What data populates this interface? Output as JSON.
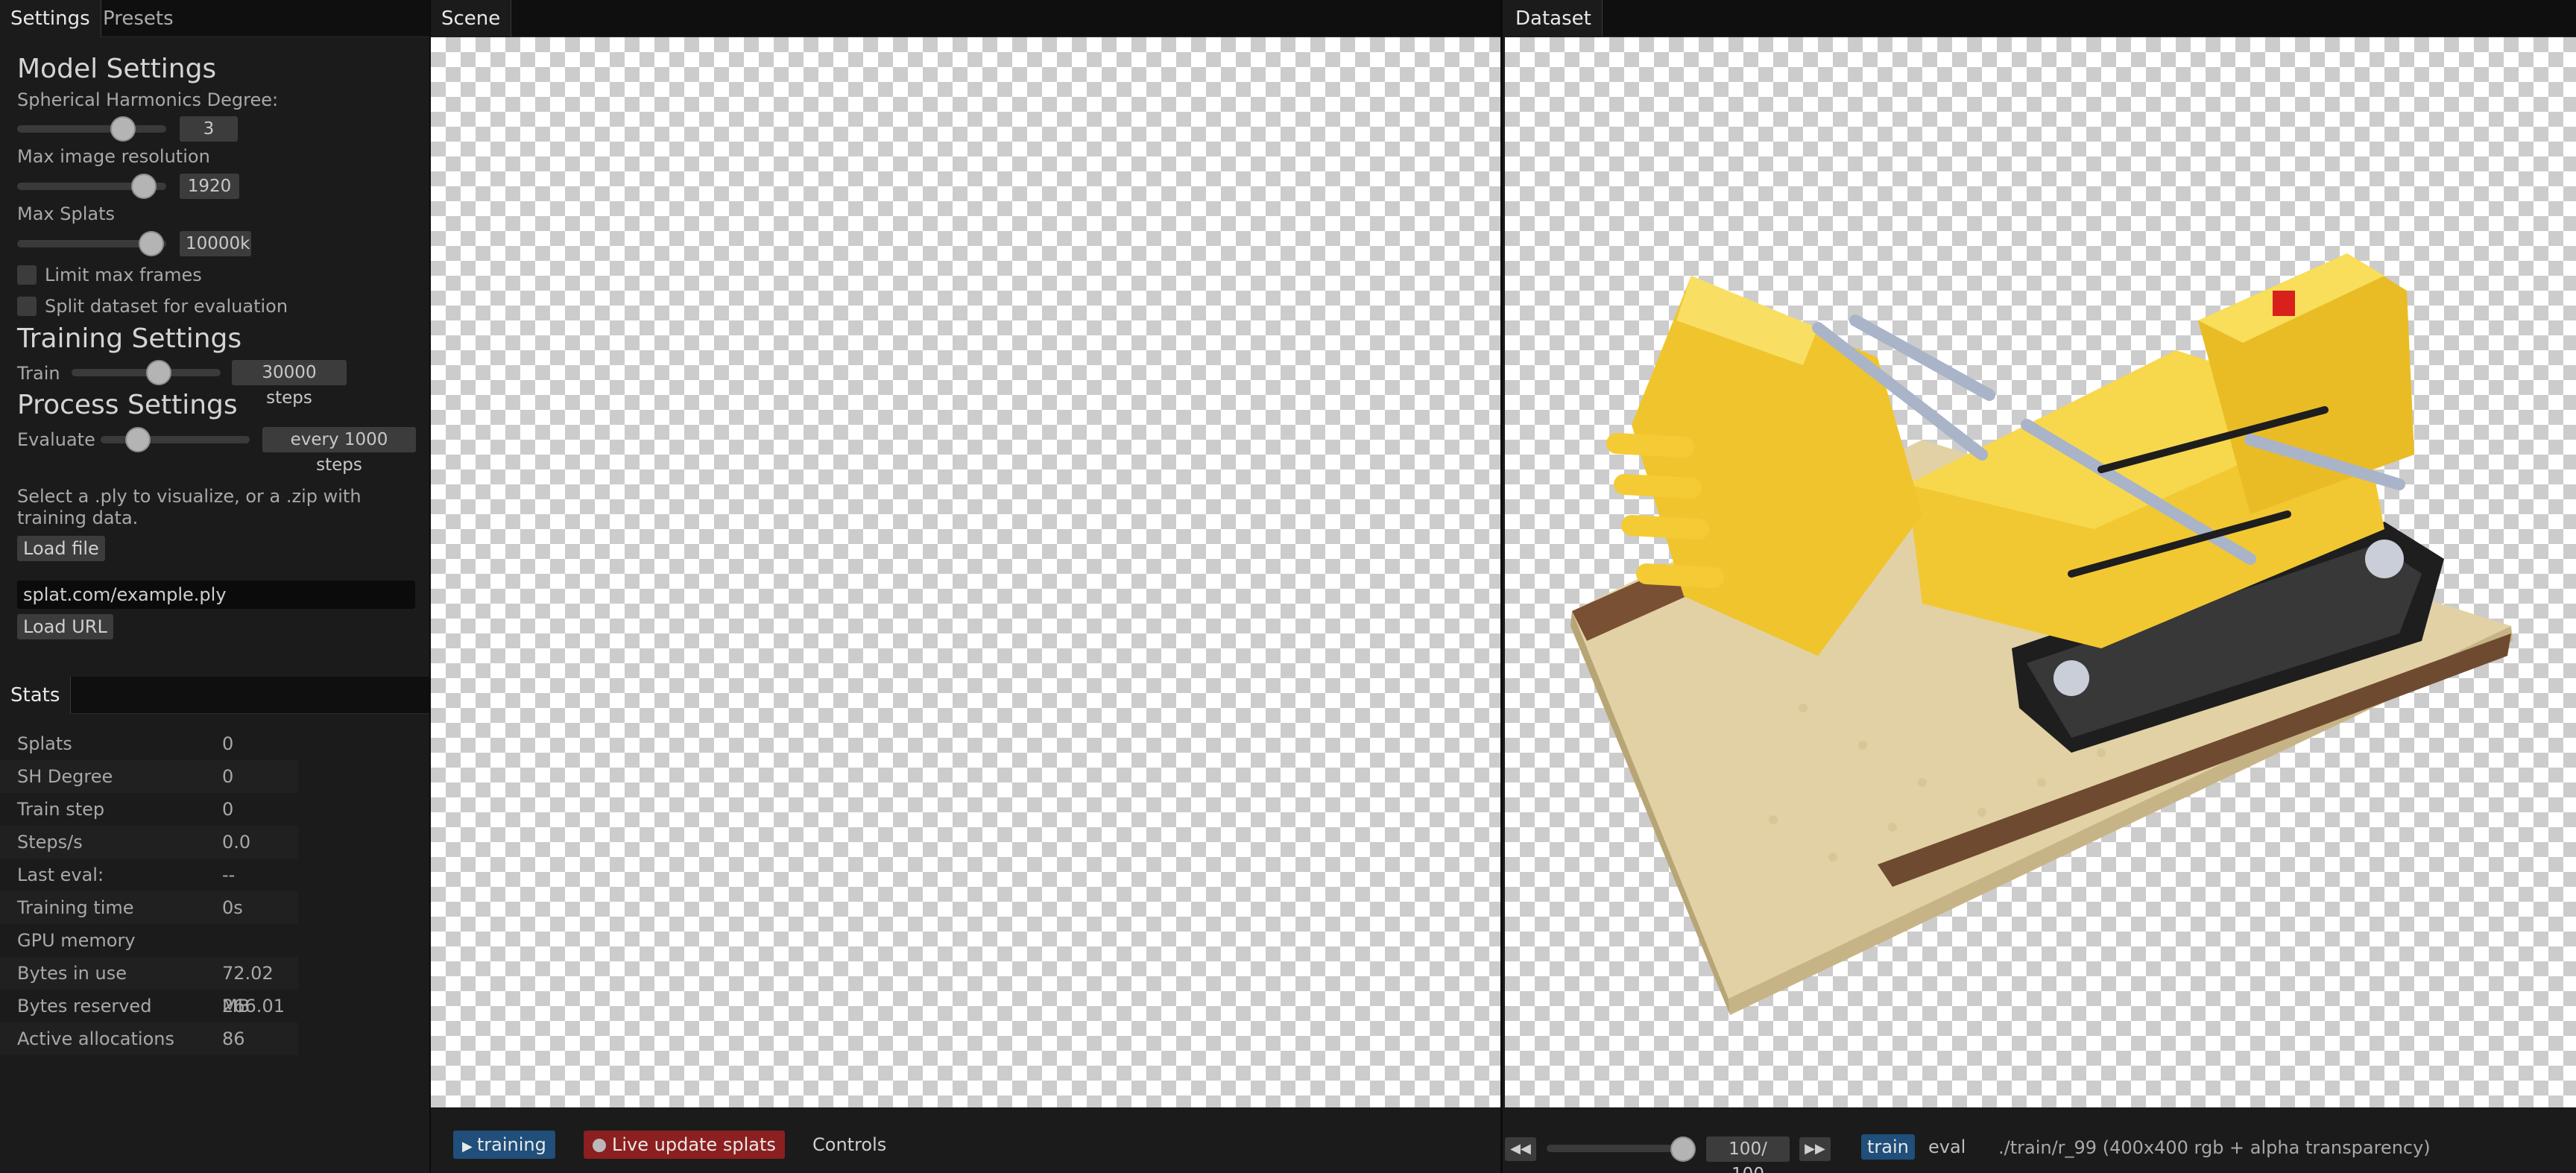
{
  "left_tabs": [
    "Settings",
    "Presets"
  ],
  "model_settings": {
    "title": "Model Settings",
    "sh_degree_label": "Spherical Harmonics Degree:",
    "sh_degree_value": "3",
    "sh_degree_fraction": 0.75,
    "max_res_label": "Max image resolution",
    "max_res_value": "1920",
    "max_res_fraction": 0.92,
    "max_splats_label": "Max Splats",
    "max_splats_value": "10000k",
    "max_splats_fraction": 0.98,
    "limit_frames_label": "Limit max frames",
    "limit_frames_checked": false,
    "split_dataset_label": "Split dataset for evaluation",
    "split_dataset_checked": false
  },
  "training_settings": {
    "title": "Training Settings",
    "train_label": "Train",
    "train_value": "30000 steps",
    "train_fraction": 0.6
  },
  "process_settings": {
    "title": "Process Settings",
    "evaluate_label": "Evaluate",
    "evaluate_value": "every 1000 steps",
    "evaluate_fraction": 0.2
  },
  "load": {
    "help_text": "Select a .ply to visualize, or a .zip with training data.",
    "load_file_label": "Load file",
    "url_value": "splat.com/example.ply",
    "load_url_label": "Load URL"
  },
  "stats": {
    "tab": "Stats",
    "rows": [
      {
        "name": "Splats",
        "value": "0"
      },
      {
        "name": "SH Degree",
        "value": "0"
      },
      {
        "name": "Train step",
        "value": "0"
      },
      {
        "name": "Steps/s",
        "value": "0.0"
      },
      {
        "name": "Last eval:",
        "value": "--"
      },
      {
        "name": "Training time",
        "value": "0s"
      },
      {
        "name": "GPU memory",
        "value": ""
      },
      {
        "name": "Bytes in use",
        "value": "72.02 MB"
      },
      {
        "name": "Bytes reserved",
        "value": "266.01 MB"
      },
      {
        "name": "Active allocations",
        "value": "86"
      }
    ]
  },
  "scene": {
    "tab": "Scene",
    "training_label": "training",
    "live_update_label": "Live update splats",
    "controls_label": "Controls"
  },
  "dataset": {
    "tab": "Dataset",
    "frame_counter": "100/ 100",
    "frame_fraction": 1.0,
    "train_label": "train",
    "eval_label": "eval",
    "image_info": "./train/r_99 (400x400 rgb + alpha transparency)"
  },
  "colors": {
    "accent_blue": "#1f4f7a",
    "live_red": "#8c1f1f",
    "lego_yellow": "#f2c832",
    "baseplate": "#e2d1a4"
  }
}
